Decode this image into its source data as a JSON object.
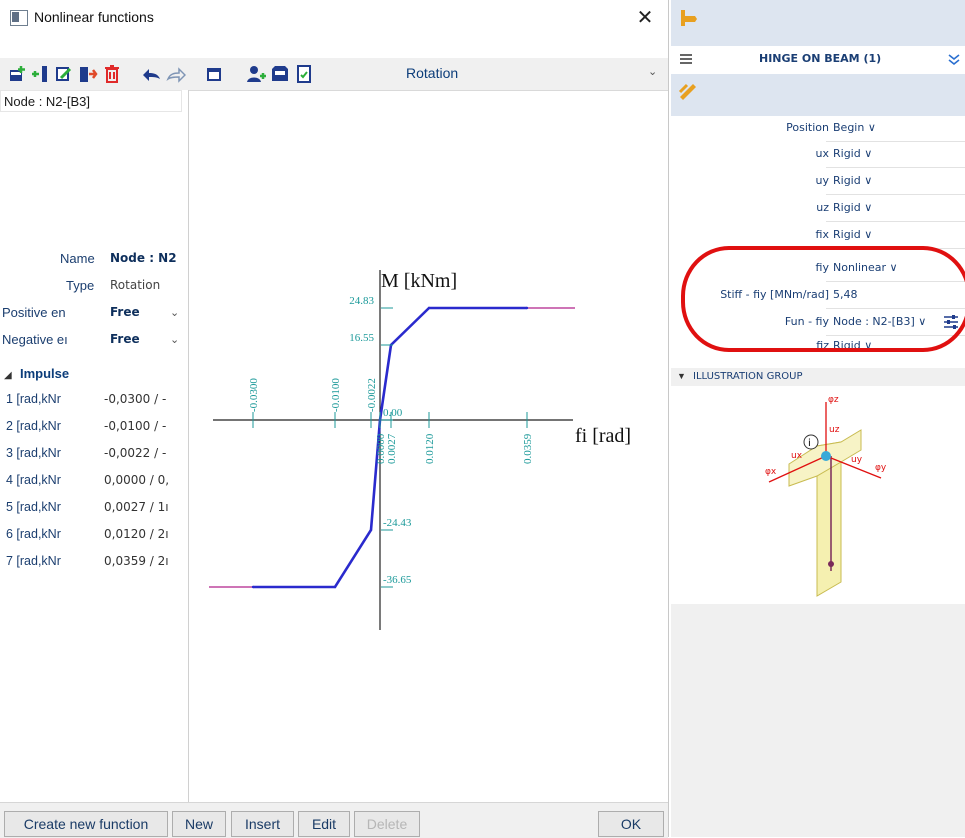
{
  "dialog": {
    "title": "Nonlinear functions",
    "function_type": "Rotation",
    "node_header": "Node : N2-[B3]",
    "properties": [
      {
        "label": "Name",
        "value": "Node : N2"
      },
      {
        "label": "Type",
        "value": "Rotation"
      },
      {
        "label": "Positive en",
        "value": "Free"
      },
      {
        "label": "Negative eı",
        "value": "Free"
      }
    ],
    "impulse_label": "Impulse",
    "impulse_rows": [
      {
        "label": "1 [rad,kNr",
        "value": "-0,0300 / -"
      },
      {
        "label": "2 [rad,kNr",
        "value": "-0,0100 / -"
      },
      {
        "label": "3 [rad,kNr",
        "value": "-0,0022 / -"
      },
      {
        "label": "4 [rad,kNr",
        "value": "0,0000 / 0,"
      },
      {
        "label": "5 [rad,kNr",
        "value": "0,0027 / 1ı"
      },
      {
        "label": "6 [rad,kNr",
        "value": "0,0120 / 2ı"
      },
      {
        "label": "7 [rad,kNr",
        "value": "0,0359 / 2ı"
      }
    ],
    "buttons": {
      "create": "Create new function",
      "new": "New",
      "insert": "Insert",
      "edit": "Edit",
      "delete": "Delete",
      "ok": "OK"
    },
    "close_symbol": "✕"
  },
  "chart_data": {
    "type": "line",
    "xlabel": "fi [rad]",
    "ylabel": "M [kNm]",
    "x": [
      -0.03,
      -0.01,
      -0.0022,
      0.0,
      0.0027,
      0.012,
      0.0359
    ],
    "y": [
      -36.65,
      -36.65,
      -24.43,
      0.0,
      16.55,
      24.83,
      24.83
    ],
    "x_tick_labels": [
      "-0.0300",
      "-0.0100",
      "-0.0022",
      "0.0000",
      "0.0027",
      "0.0120",
      "0.0359"
    ],
    "y_tick_labels": [
      "24.83",
      "16.55",
      "0.00",
      "-24.43",
      "-36.65"
    ],
    "line_color": "#2a2acd",
    "extension_color": "#b0208a",
    "tick_color": "#1c9a9a"
  },
  "right_panel": {
    "title": "HINGE ON BEAM (1)",
    "rows": [
      {
        "label": "Position",
        "value": "Begin ∨"
      },
      {
        "label": "ux",
        "value": "Rigid ∨"
      },
      {
        "label": "uy",
        "value": "Rigid ∨"
      },
      {
        "label": "uz",
        "value": "Rigid ∨"
      },
      {
        "label": "fix",
        "value": "Rigid ∨"
      },
      {
        "label": "fiy",
        "value": "Nonlinear ∨"
      },
      {
        "label": "Stiff - fiy [MNm/rad]",
        "value": "5,48"
      },
      {
        "label": "Fun - fiy",
        "value": "Node : N2-[B3] ∨"
      },
      {
        "label": "fiz",
        "value": "Rigid ∨"
      }
    ],
    "illustration_group": "ILLUSTRATION GROUP",
    "illus_labels": {
      "qz": "φz",
      "uz": "uz",
      "qx": "φx",
      "ux": "ux",
      "uy": "uy",
      "qy": "φy",
      "info": "i"
    }
  }
}
